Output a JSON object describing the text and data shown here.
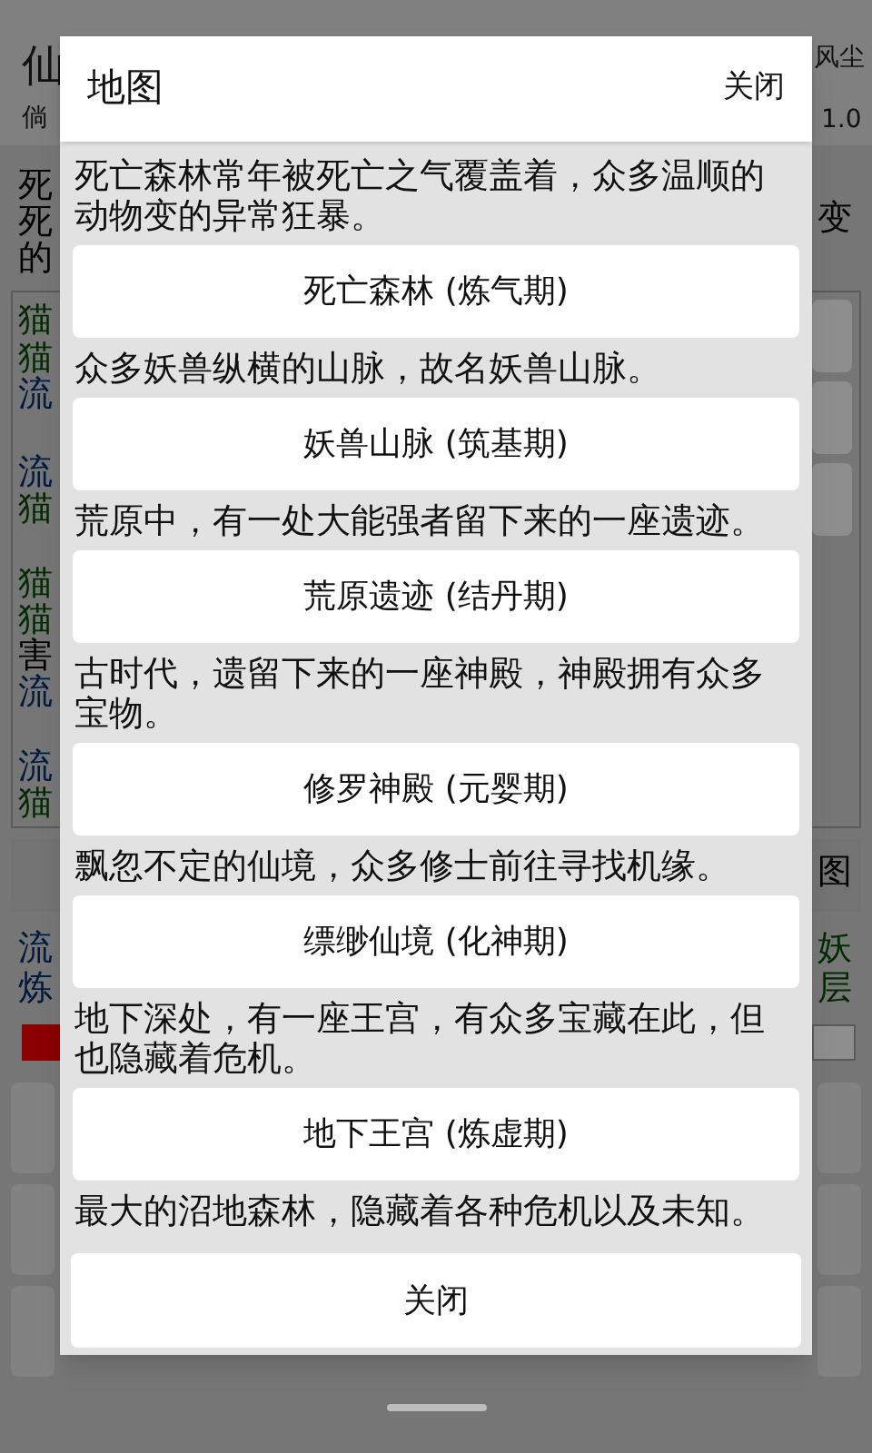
{
  "background": {
    "title": "仙",
    "subtitle": "倘",
    "top_right": "风尘",
    "version": "1.0",
    "left_fragments": [
      {
        "text": "死",
        "color": "#000000"
      },
      {
        "text": "死",
        "color": "#000000"
      },
      {
        "text": "的",
        "color": "#000000"
      },
      {
        "text": "猫",
        "color": "#002a00"
      },
      {
        "text": "猫",
        "color": "#002a00"
      },
      {
        "text": "流",
        "color": "#001a40"
      },
      {
        "text": "流",
        "color": "#001a40"
      },
      {
        "text": "猫",
        "color": "#002a00"
      },
      {
        "text": "猫",
        "color": "#002a00"
      },
      {
        "text": "猫",
        "color": "#002a00"
      },
      {
        "text": "害",
        "color": "#000000"
      },
      {
        "text": "流",
        "color": "#001a40"
      },
      {
        "text": "流",
        "color": "#001a40"
      },
      {
        "text": "猫",
        "color": "#002a00"
      },
      {
        "text": "流",
        "color": "#001a40"
      },
      {
        "text": "炼",
        "color": "#001a40"
      }
    ],
    "right_fragments": [
      {
        "text": "变",
        "color": "#000000"
      },
      {
        "text": "图",
        "color": "#000000"
      },
      {
        "text": "妖",
        "color": "#002a00"
      },
      {
        "text": "层",
        "color": "#002a00"
      }
    ]
  },
  "dialog": {
    "title": "地图",
    "header_close": "关闭",
    "areas": [
      {
        "description": "死亡森林常年被死亡之气覆盖着，众多温顺的动物变的异常狂暴。",
        "button": "死亡森林 (炼气期)"
      },
      {
        "description": "众多妖兽纵横的山脉，故名妖兽山脉。",
        "button": "妖兽山脉 (筑基期)"
      },
      {
        "description": "荒原中，有一处大能强者留下来的一座遗迹。",
        "button": "荒原遗迹 (结丹期)"
      },
      {
        "description": "古时代，遗留下来的一座神殿，神殿拥有众多宝物。",
        "button": "修罗神殿 (元婴期)"
      },
      {
        "description": "飘忽不定的仙境，众多修士前往寻找机缘。",
        "button": "缥缈仙境 (化神期)"
      },
      {
        "description": "地下深处，有一座王宫，有众多宝藏在此，但也隐藏着危机。",
        "button": "地下王宫 (炼虚期)"
      },
      {
        "description": "最大的沼地森林，隐藏着各种危机以及未知。"
      }
    ],
    "footer_close": "关闭"
  }
}
